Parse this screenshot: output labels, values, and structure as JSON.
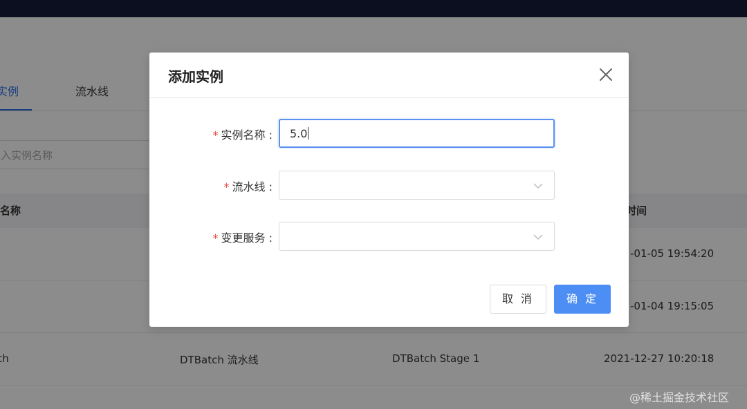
{
  "tabs": {
    "active_label": "实例",
    "second_label": "流水线"
  },
  "search": {
    "placeholder": "入实例名称"
  },
  "table": {
    "headers": {
      "name": "名称",
      "time": "时间"
    },
    "rows": [
      {
        "name": "",
        "pipeline": "",
        "stage": "",
        "time": "-01-05 19:54:20"
      },
      {
        "name": "",
        "pipeline": "",
        "stage": "",
        "time": "-01-04 19:15:05"
      },
      {
        "name": "ch",
        "pipeline": "DTBatch 流水线",
        "stage": "DTBatch Stage 1",
        "time": "2021-12-27 10:20:18"
      }
    ]
  },
  "modal": {
    "title": "添加实例",
    "fields": [
      {
        "label": "实例名称 :",
        "value": "5.0"
      },
      {
        "label": "流水线 :",
        "value": ""
      },
      {
        "label": "变更服务 :",
        "value": ""
      }
    ],
    "required_mark": "*",
    "cancel_label": "取 消",
    "ok_label": "确 定"
  },
  "watermark": "@稀土掘金技术社区",
  "colors": {
    "primary": "#4d8ef4",
    "required": "#e5493e",
    "topbar": "#0b0f1f"
  },
  "icons": {
    "close": "close-icon",
    "dropdown": "chevron-down-icon"
  }
}
